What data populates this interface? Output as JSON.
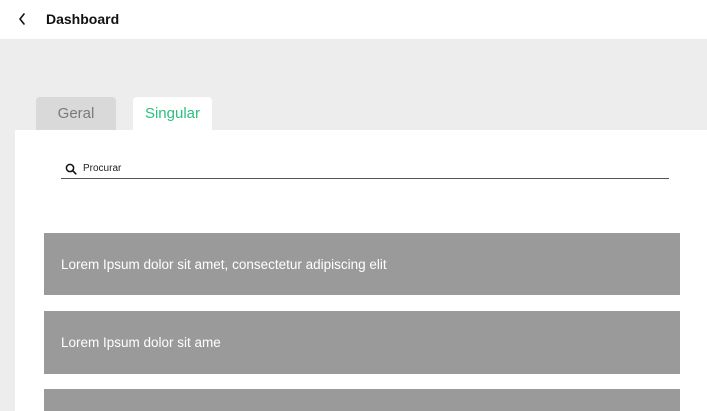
{
  "header": {
    "title": "Dashboard",
    "back_icon": "chevron-left-icon"
  },
  "tabs": [
    {
      "label": "Geral",
      "active": false
    },
    {
      "label": "Singular",
      "active": true
    }
  ],
  "search": {
    "placeholder": "Procurar",
    "icon": "search-icon"
  },
  "list": {
    "items": [
      {
        "text": "Lorem Ipsum dolor sit amet, consectetur adipiscing elit"
      },
      {
        "text": "Lorem Ipsum dolor sit ame"
      },
      {
        "text": ""
      }
    ]
  },
  "colors": {
    "active_tab_text": "#2bbf7e",
    "inactive_tab_bg": "#d9d9d9",
    "card_bg": "#9a9a9a",
    "page_bg": "#ededed"
  }
}
